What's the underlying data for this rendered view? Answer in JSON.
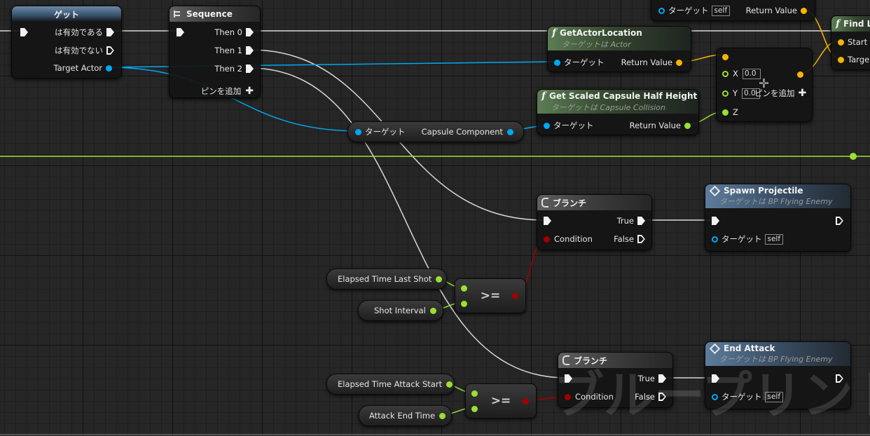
{
  "getter_node": {
    "title": "ゲット",
    "is_valid": "は有効である",
    "is_not_valid": "は有効でない",
    "target_actor": "Target Actor"
  },
  "sequence_node": {
    "title": "Sequence",
    "then0": "Then 0",
    "then1": "Then 1",
    "then2": "Then 2",
    "add_pin": "ピンを追加"
  },
  "get_actor_location": {
    "title": "GetActorLocation",
    "subtitle": "ターゲットは Actor",
    "target": "ターゲット",
    "return_value": "Return Value"
  },
  "top_node": {
    "target": "ターゲット",
    "self": "self",
    "return_value": "Return Value"
  },
  "find_node": {
    "title": "Find L",
    "start": "Start",
    "target": "Targe"
  },
  "make_vector": {
    "x_label": "X",
    "x_value": "0.0",
    "y_label": "Y",
    "y_value": "0.0",
    "add_pin": "ピンを追加"
  },
  "capsule_half_height": {
    "title": "Get Scaled Capsule Half Height",
    "subtitle": "ターゲットは Capsule Collision",
    "target": "ターゲット",
    "return_value": "Return Value"
  },
  "capsule_getter": {
    "target": "ターゲット",
    "output": "Capsule Component"
  },
  "branch1": {
    "title": "ブランチ",
    "true_label": "True",
    "condition": "Condition",
    "false_label": "False"
  },
  "spawn_projectile": {
    "title": "Spawn Projectile",
    "subtitle": "ターゲットは BP Flying Enemy",
    "target": "ターゲット",
    "self": "self"
  },
  "elapsed_last_shot": {
    "label": "Elapsed Time Last Shot"
  },
  "shot_interval": {
    "label": "Shot Interval"
  },
  "compare1": {
    "op": ">="
  },
  "branch2": {
    "title": "ブランチ",
    "true_label": "True",
    "condition": "Condition",
    "false_label": "False"
  },
  "end_attack": {
    "title": "End Attack",
    "subtitle": "ターゲットは BP Flying Enemy",
    "target": "ターゲット",
    "self": "self"
  },
  "elapsed_attack_start": {
    "label": "Elapsed Time Attack Start"
  },
  "attack_end_time": {
    "label": "Attack End Time"
  },
  "compare2": {
    "op": ">="
  },
  "watermark": "ブループリント",
  "colors": {
    "exec": "#f2f2f2",
    "object": "#00a8f0",
    "vector": "#f7b500",
    "float": "#9be030",
    "bool": "#a10000"
  }
}
